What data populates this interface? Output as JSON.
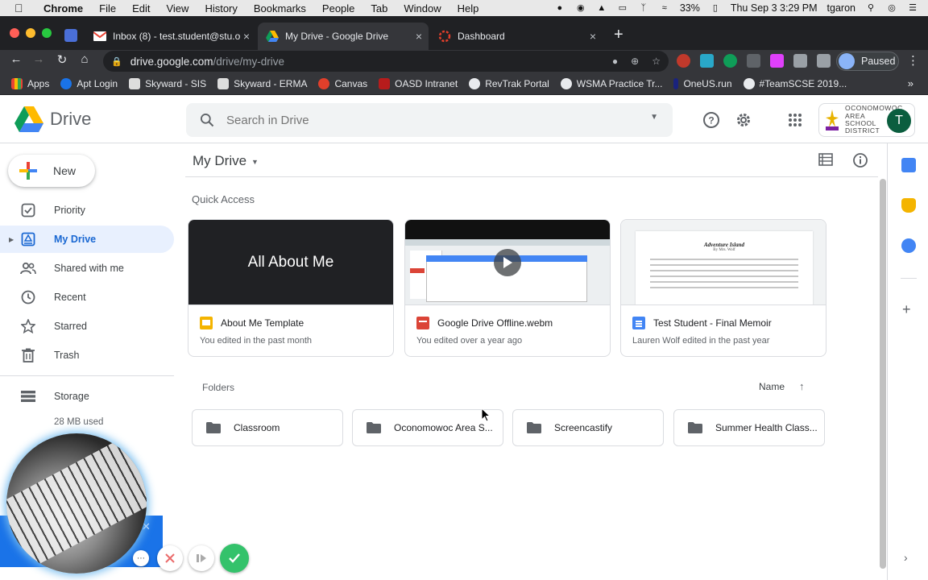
{
  "menubar": {
    "app": "Chrome",
    "items": [
      "File",
      "Edit",
      "View",
      "History",
      "Bookmarks",
      "People",
      "Tab",
      "Window",
      "Help"
    ],
    "battery": "33%",
    "datetime": "Thu Sep 3  3:29 PM",
    "user": "tgaron"
  },
  "tabs": [
    {
      "title": "Inbox (8) - test.student@stu.o",
      "close": "×"
    },
    {
      "title": "My Drive - Google Drive",
      "close": "×"
    },
    {
      "title": "Dashboard",
      "close": "×"
    }
  ],
  "newtab": "+",
  "toolbar": {
    "url_host": "drive.google.com",
    "url_path": "/drive/my-drive",
    "profile_status": "Paused"
  },
  "bookmarks": [
    "Apps",
    "Apt Login",
    "Skyward - SIS",
    "Skyward - ERMA",
    "Canvas",
    "OASD Intranet",
    "RevTrak Portal",
    "WSMA Practice Tr...",
    "OneUS.run",
    "#TeamSCSE 2019..."
  ],
  "bookmarks_more": "»",
  "drive": {
    "logo_text": "Drive",
    "search_placeholder": "Search in Drive",
    "org_name": "OCONOMOWOC AREA SCHOOL DISTRICT",
    "avatar_letter": "T"
  },
  "sidebar": {
    "new_label": "New",
    "items": [
      {
        "label": "Priority",
        "icon": "priority-icon"
      },
      {
        "label": "My Drive",
        "icon": "my-drive-icon"
      },
      {
        "label": "Shared with me",
        "icon": "shared-icon"
      },
      {
        "label": "Recent",
        "icon": "clock-icon"
      },
      {
        "label": "Starred",
        "icon": "star-icon"
      },
      {
        "label": "Trash",
        "icon": "trash-icon"
      }
    ],
    "storage_label": "Storage",
    "storage_used": "28 MB used"
  },
  "main": {
    "title": "My Drive",
    "quick_access_label": "Quick Access",
    "cards": [
      {
        "name": "About Me Template",
        "sub": "You edited in the past month",
        "thumb_text": "All About Me",
        "type_color": "#f4b400"
      },
      {
        "name": "Google Drive Offline.webm",
        "sub": "You edited over a year ago",
        "type_color": "#db4437"
      },
      {
        "name": "Test Student - Final Memoir",
        "sub": "Lauren Wolf edited in the past year",
        "type_color": "#4285f4",
        "doc_title": "Adventure Island",
        "doc_author": "By Mrs. Wolf"
      }
    ],
    "folders_label": "Folders",
    "sort_label": "Name",
    "folders": [
      "Classroom",
      "Oconomowoc Area S...",
      "Screencastify",
      "Summer Health Class..."
    ]
  },
  "colors": {
    "accent": "#1967d2",
    "active_bg": "#e8f0fe",
    "tabstrip_bg": "#202124",
    "toolbar_bg": "#35363a"
  }
}
